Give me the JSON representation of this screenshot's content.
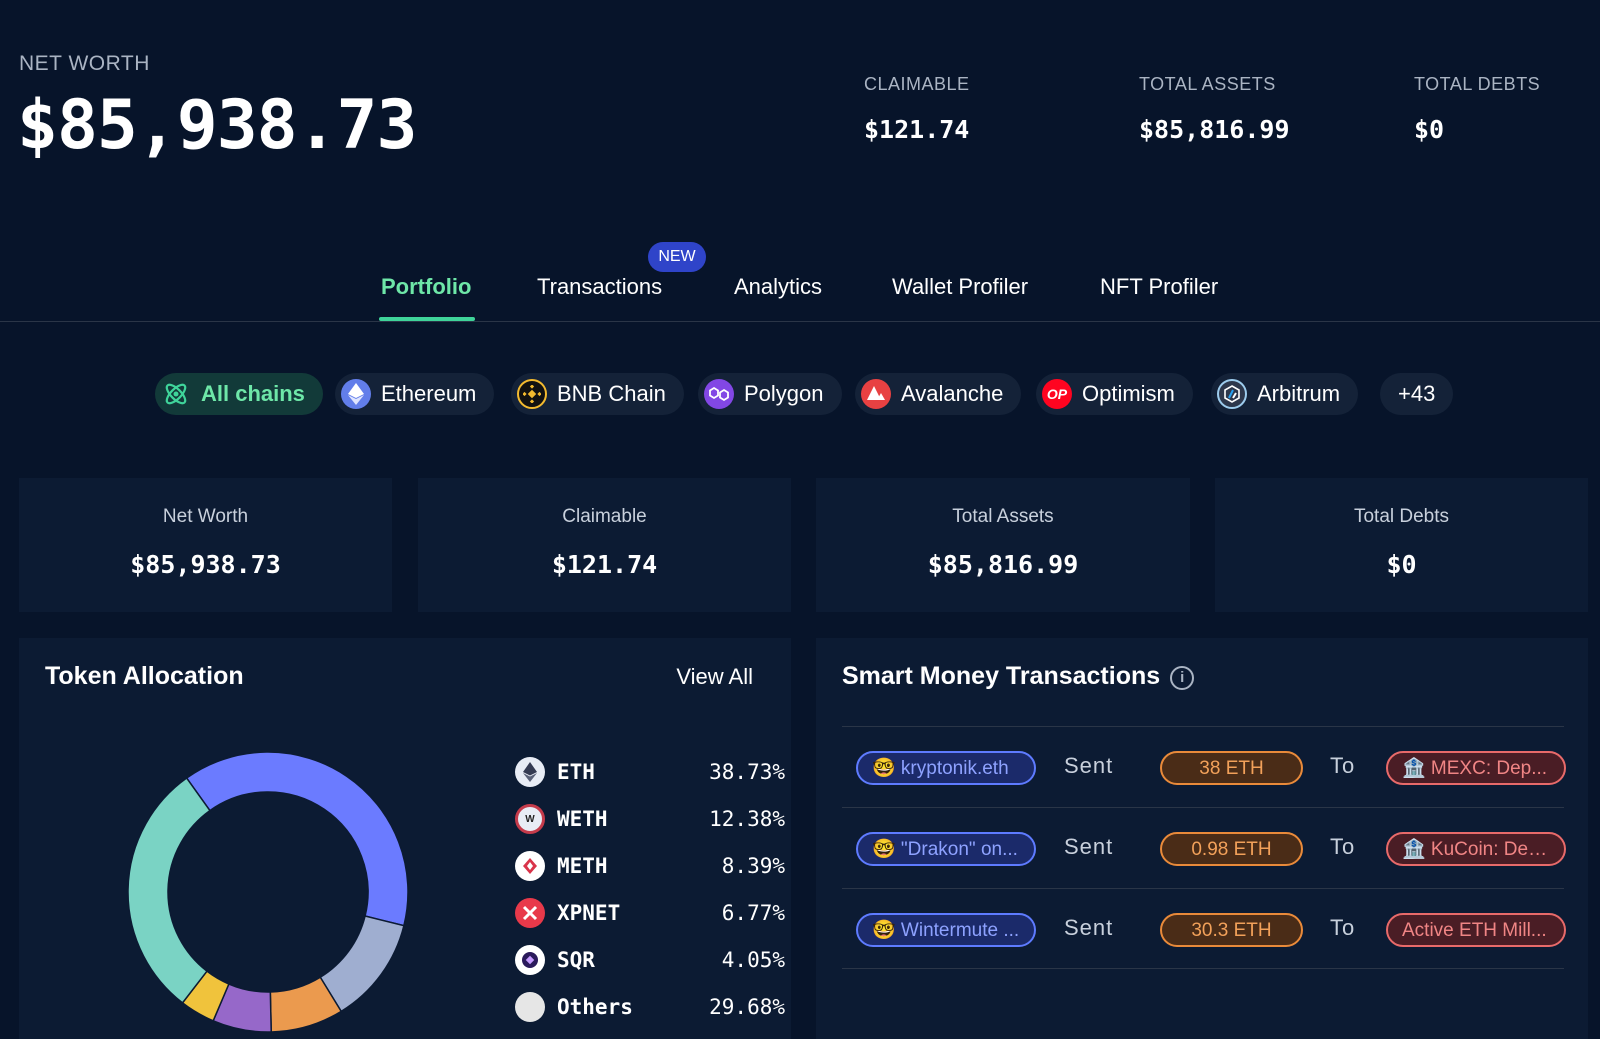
{
  "header": {
    "net_worth_label": "NET WORTH",
    "net_worth_value": "$85,938.73",
    "stats": [
      {
        "label": "CLAIMABLE",
        "value": "$121.74"
      },
      {
        "label": "TOTAL ASSETS",
        "value": "$85,816.99"
      },
      {
        "label": "TOTAL DEBTS",
        "value": "$0"
      }
    ]
  },
  "tabs": [
    {
      "label": "Portfolio",
      "active": true
    },
    {
      "label": "Transactions",
      "badge": "NEW"
    },
    {
      "label": "Analytics"
    },
    {
      "label": "Wallet Profiler"
    },
    {
      "label": "NFT Profiler"
    }
  ],
  "chains": [
    {
      "label": "All chains",
      "icon": "all-chains-icon",
      "active": true
    },
    {
      "label": "Ethereum",
      "icon": "ethereum-icon",
      "color": "#627eea"
    },
    {
      "label": "BNB Chain",
      "icon": "bnb-icon",
      "color": "#f3ba2f"
    },
    {
      "label": "Polygon",
      "icon": "polygon-icon",
      "color": "#8247e5"
    },
    {
      "label": "Avalanche",
      "icon": "avalanche-icon",
      "color": "#e84142"
    },
    {
      "label": "Optimism",
      "icon": "optimism-icon",
      "color": "#ff0420",
      "icon_text": "OP"
    },
    {
      "label": "Arbitrum",
      "icon": "arbitrum-icon",
      "color": "#2d374b"
    },
    {
      "label": "+43"
    }
  ],
  "cards": [
    {
      "label": "Net Worth",
      "value": "$85,938.73"
    },
    {
      "label": "Claimable",
      "value": "$121.74"
    },
    {
      "label": "Total Assets",
      "value": "$85,816.99"
    },
    {
      "label": "Total Debts",
      "value": "$0"
    }
  ],
  "token_allocation": {
    "title": "Token Allocation",
    "view_all": "View All"
  },
  "chart_data": {
    "type": "pie",
    "categories": [
      "ETH",
      "WETH",
      "METH",
      "XPNET",
      "SQR",
      "Others"
    ],
    "values": [
      38.73,
      12.38,
      8.39,
      6.77,
      4.05,
      29.68
    ],
    "labels": [
      "38.73%",
      "12.38%",
      "8.39%",
      "6.77%",
      "4.05%",
      "29.68%"
    ],
    "colors": [
      "#6b7bff",
      "#9faed0",
      "#eb9a4e",
      "#9668c9",
      "#f0c33c",
      "#7ad3c4"
    ],
    "legend_icon_colors": [
      "#e8ecf5",
      "#e8ecf5",
      "#ffffff",
      "#e8394a",
      "#ffffff",
      "#e6e6e6"
    ],
    "donut": true,
    "legend_position": "right"
  },
  "smart_money": {
    "title": "Smart Money Transactions",
    "sent_word": "Sent",
    "to_word": "To",
    "rows": [
      {
        "who": "🤓 kryptonik.eth",
        "amount": "38 ETH",
        "dest": "🏦 MEXC: Dep..."
      },
      {
        "who": "🤓 \"Drakon\" on...",
        "amount": "0.98 ETH",
        "dest": "🏦 KuCoin: Dep..."
      },
      {
        "who": "🤓 Wintermute ...",
        "amount": "30.3 ETH",
        "dest": "Active ETH Mill..."
      }
    ]
  }
}
